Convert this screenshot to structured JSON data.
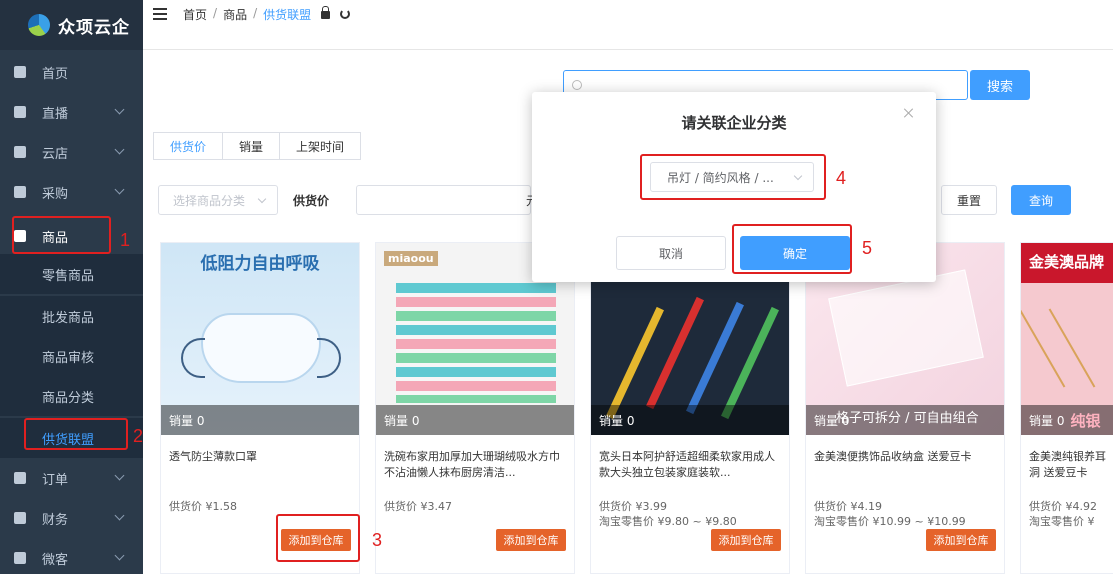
{
  "app": {
    "name": "众项云企"
  },
  "sidebar": {
    "items": [
      {
        "label": "首页",
        "icon": "home-icon"
      },
      {
        "label": "直播",
        "icon": "live-icon"
      },
      {
        "label": "云店",
        "icon": "store-icon"
      },
      {
        "label": "采购",
        "icon": "purchase-icon"
      },
      {
        "label": "商品",
        "icon": "goods-icon"
      },
      {
        "label": "订单",
        "icon": "order-icon"
      },
      {
        "label": "财务",
        "icon": "finance-icon"
      },
      {
        "label": "微客",
        "icon": "wechat-icon"
      }
    ],
    "sub_items": [
      "零售商品",
      "批发商品",
      "商品审核",
      "商品分类",
      "供货联盟"
    ]
  },
  "breadcrumb": {
    "home": "首页",
    "goods": "商品",
    "current": "供货联盟"
  },
  "search": {
    "button": "搜索"
  },
  "tabs": [
    "供货价",
    "销量",
    "上架时间"
  ],
  "filters": {
    "category_placeholder": "选择商品分类",
    "price_label": "供货价",
    "unit": "元",
    "reset": "重置",
    "query": "查询"
  },
  "products": [
    {
      "banner": "低阻力自由呼吸",
      "sales": "销量 0",
      "title": "透气防尘薄款口罩",
      "price": "供货价 ¥1.58",
      "taobao": "",
      "add": "添加到仓库"
    },
    {
      "banner": "miaoou",
      "sales": "销量 0",
      "title": "洗碗布家用加厚加大珊瑚绒吸水方巾不沾油懒人抹布厨房清洁...",
      "price": "供货价 ¥3.47",
      "taobao": "",
      "add": "添加到仓库"
    },
    {
      "banner": "",
      "sales": "销量 0",
      "title": "宽头日本阿护舒适超细柔软家用成人款大头独立包装家庭装软...",
      "price": "供货价 ¥3.99",
      "taobao": "淘宝零售价 ¥9.80 ~ ¥9.80",
      "add": "添加到仓库"
    },
    {
      "banner": "格子可拆分 / 可自由组合",
      "sales": "销量 0",
      "title": "金美澳便携饰品收纳盒 送爱豆卡",
      "price": "供货价 ¥4.19",
      "taobao": "淘宝零售价 ¥10.99 ~ ¥10.99",
      "add": "添加到仓库"
    },
    {
      "banner": "金美澳品牌",
      "sales": "销量 0",
      "overlay": "纯银",
      "title": "金美澳纯银养耳洞 送爱豆卡",
      "price": "供货价 ¥4.92",
      "taobao": "淘宝零售价 ¥",
      "add": "添加到仓库"
    }
  ],
  "dialog": {
    "title": "请关联企业分类",
    "category_value": "吊灯 / 简约风格 / ...",
    "cancel": "取消",
    "confirm": "确定"
  },
  "annotations": [
    "1",
    "2",
    "3",
    "4",
    "5"
  ],
  "colors": {
    "primary": "#409eff",
    "sidebar": "#2b3a4a",
    "add_button": "#e5632a",
    "annotation": "#e02020"
  }
}
